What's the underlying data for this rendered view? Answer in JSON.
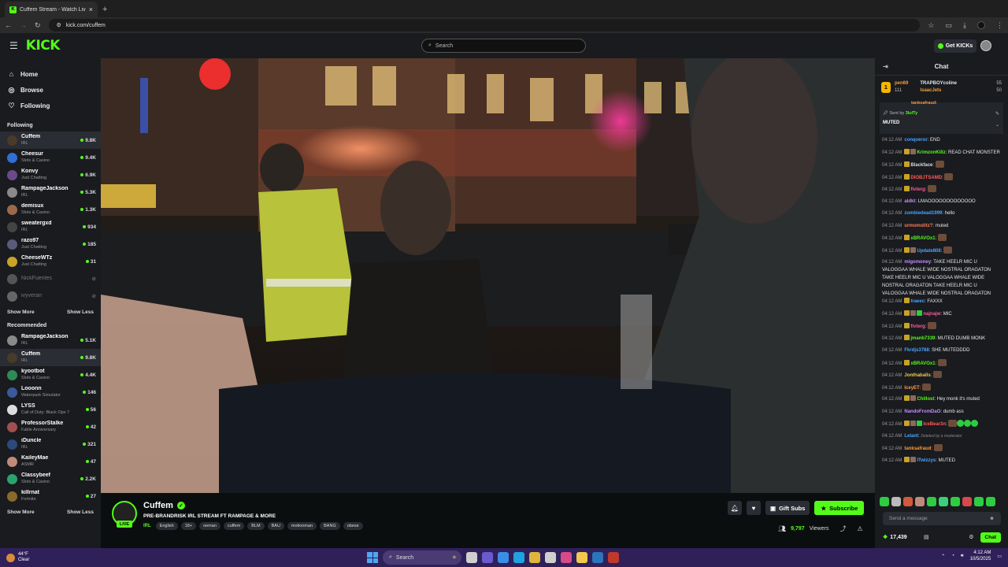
{
  "browser": {
    "tab_title": "Cuffem Stream - Watch Live on Kick",
    "url": "kick.com/cuffem",
    "new_tab_icon": "+"
  },
  "topnav": {
    "logo": "KICK",
    "search_placeholder": "Search",
    "get_kicks": "Get KICKs"
  },
  "sidebar": {
    "nav": [
      {
        "label": "Home",
        "icon": "home-icon"
      },
      {
        "label": "Browse",
        "icon": "compass-icon"
      },
      {
        "label": "Following",
        "icon": "heart-icon"
      }
    ],
    "following_header": "Following",
    "following": [
      {
        "name": "Cuffem",
        "category": "IRL",
        "viewers": "9.8K",
        "color": "#4a3a2a",
        "active": true
      },
      {
        "name": "Cheesur",
        "category": "Slots & Casino",
        "viewers": "9.4K",
        "color": "#2f6fd6"
      },
      {
        "name": "Konvy",
        "category": "Just Chatting",
        "viewers": "6.9K",
        "color": "#6b4a8a"
      },
      {
        "name": "RampageJackson",
        "category": "IRL",
        "viewers": "5.3K",
        "color": "#8a8a8a"
      },
      {
        "name": "demisux",
        "category": "Slots & Casino",
        "viewers": "1.3K",
        "color": "#9a6a4a"
      },
      {
        "name": "sweatergxd",
        "category": "IRL",
        "viewers": "934",
        "color": "#444"
      },
      {
        "name": "razo97",
        "category": "Just Chatting",
        "viewers": "185",
        "color": "#5a5a7a"
      },
      {
        "name": "CheeseWTz",
        "category": "Just Chatting",
        "viewers": "31",
        "color": "#c9a227"
      },
      {
        "name": "NickFuentes",
        "category": "",
        "viewers": "",
        "color": "#555",
        "offline": true
      },
      {
        "name": "ivyveran",
        "category": "",
        "viewers": "",
        "color": "#666",
        "offline": true
      }
    ],
    "show_more": "Show More",
    "show_less": "Show Less",
    "recommended_header": "Recommended",
    "recommended": [
      {
        "name": "RampageJackson",
        "category": "IRL",
        "viewers": "5.1K",
        "color": "#8a8a8a"
      },
      {
        "name": "Cuffem",
        "category": "IRL",
        "viewers": "9.8K",
        "color": "#4a3a2a",
        "active": true
      },
      {
        "name": "kyootbot",
        "category": "Slots & Casino",
        "viewers": "4.4K",
        "color": "#2e8b57"
      },
      {
        "name": "Looonn",
        "category": "Waterpark Simulator",
        "viewers": "146",
        "color": "#3a5a9a"
      },
      {
        "name": "LYSS",
        "category": "Call of Duty: Black Ops 7",
        "viewers": "56",
        "color": "#ddd"
      },
      {
        "name": "ProfessorStalke",
        "category": "Fable Anniversary",
        "viewers": "42",
        "color": "#a05050"
      },
      {
        "name": "iDuncle",
        "category": "IRL",
        "viewers": "321",
        "color": "#2a4a7a"
      },
      {
        "name": "KaileyMae",
        "category": "ASMR",
        "viewers": "47",
        "color": "#c08a7a"
      },
      {
        "name": "Classybeef",
        "category": "Slots & Casino",
        "viewers": "2.2K",
        "color": "#2ba36a"
      },
      {
        "name": "killrnat",
        "category": "Fortnite",
        "viewers": "27",
        "color": "#8a6a2a"
      }
    ]
  },
  "stream": {
    "channel": "Cuffem",
    "live_label": "LIVE",
    "title": "PRE-BRANDRISK IRL STREAM FT RAMPAGE & MORE",
    "category": "IRL",
    "tags": [
      "English",
      "18+",
      "oeman",
      "cuffem",
      "BLM",
      "BAU",
      "motionman",
      "BANG",
      "obese"
    ],
    "gift_subs": "Gift Subs",
    "subscribe": "Subscribe",
    "viewers": "9,797",
    "viewers_label": "Viewers"
  },
  "chat": {
    "title": "Chat",
    "leaderboard": {
      "first": {
        "name": "pen69",
        "count": "111"
      },
      "second": {
        "name": "TRAPBOYcoline",
        "count": "55"
      },
      "third": {
        "name": "IsaacJets",
        "count": "50"
      }
    },
    "pinned": {
      "header_user": "tanksafraud:",
      "sent_by_label": "Sent by",
      "sent_by": "3lulTy",
      "message": "MUTED"
    },
    "messages": [
      {
        "time": "04:12 AM",
        "user": "conqveror",
        "color": "#4aa3ff",
        "text": "END"
      },
      {
        "time": "04:12 AM",
        "user": "KrimzonKillz",
        "color": "#53fc18",
        "text": "READ CHAT MONSTER",
        "badges": 2
      },
      {
        "time": "04:12 AM",
        "user": "Blackface",
        "color": "#dddddd",
        "text": "",
        "badges": 1,
        "emote": true
      },
      {
        "time": "04:12 AM",
        "user": "DIOBJTSAMD",
        "color": "#ff5a5a",
        "text": "",
        "badges": 1,
        "emote": true
      },
      {
        "time": "04:12 AM",
        "user": "fivterg",
        "color": "#ff5a9a",
        "text": "",
        "badges": 1,
        "emote": true
      },
      {
        "time": "04:12 AM",
        "user": "aldkt",
        "color": "#c78bff",
        "text": "LMAOOOOOOOOOOOOO"
      },
      {
        "time": "04:12 AM",
        "user": "zombiedead1999",
        "color": "#4aa3ff",
        "text": "hello"
      },
      {
        "time": "04:12 AM",
        "user": "urmomstitz?",
        "color": "#ff7a5a",
        "text": "muted"
      },
      {
        "time": "04:12 AM",
        "user": "xBRAVOx1",
        "color": "#53fc18",
        "text": "",
        "badges": 1,
        "emote": true
      },
      {
        "time": "04:12 AM",
        "user": "Update808",
        "color": "#4aa3ff",
        "text": "",
        "badges": 2,
        "emote": true
      },
      {
        "time": "04:12 AM",
        "user": "migomoney",
        "color": "#c78bff",
        "text": "TAKE HEELR MIC U VALOGGAA WHALE WIDE NOSTRAL ORAGATON TAKE HEELR MIC U VALOGGAA WHALE WIDE NOSTRAL ORAGATON TAKE HEELR MIC U VALOGGAA WHALE WIDE NOSTRAL ORAGATON"
      },
      {
        "time": "04:12 AM",
        "user": "traeec",
        "color": "#4aa3ff",
        "text": "FAXXX",
        "badges": 1
      },
      {
        "time": "04:12 AM",
        "user": "najnajw",
        "color": "#ff5a9a",
        "text": "MIC",
        "badges": 3
      },
      {
        "time": "04:12 AM",
        "user": "fivterg",
        "color": "#ff5a9a",
        "text": "",
        "badges": 1,
        "emote": true
      },
      {
        "time": "04:12 AM",
        "user": "jmanb7339",
        "color": "#53fc18",
        "text": "MUTED DUMB MONK",
        "badges": 1
      },
      {
        "time": "04:12 AM",
        "user": "Fkrdjs3788",
        "color": "#4aa3ff",
        "text": "SHE MUTEDDDD"
      },
      {
        "time": "04:12 AM",
        "user": "xBRAVOx1",
        "color": "#53fc18",
        "text": "",
        "badges": 1,
        "emote": true
      },
      {
        "time": "04:12 AM",
        "user": "Jonthaballs",
        "color": "#f2c94c",
        "text": "",
        "emote": true
      },
      {
        "time": "04:12 AM",
        "user": "IceyET",
        "color": "#ff9a3a",
        "text": "",
        "emote": true
      },
      {
        "time": "04:12 AM",
        "user": "Chillost",
        "color": "#53fc18",
        "text": "Hey monk it's muted",
        "badges": 2
      },
      {
        "time": "04:12 AM",
        "user": "NandoFromDaO",
        "color": "#c78bff",
        "text": "dumb ass"
      },
      {
        "time": "04:12 AM",
        "user": "IceBear3n",
        "color": "#ff5a5a",
        "text": "",
        "badges": 3,
        "emote": true
      },
      {
        "time": "04:12 AM",
        "user": "Lelant",
        "color": "#4aa3ff",
        "text": "Deleted by a moderator",
        "deleted": true
      },
      {
        "time": "04:12 AM",
        "user": "tanksafraud",
        "color": "#ff9a3a",
        "text": "",
        "emote": true
      },
      {
        "time": "04:12 AM",
        "user": "ITwizzys",
        "color": "#4aa3ff",
        "text": "MUTED",
        "badges": 2
      }
    ],
    "send_placeholder": "Send a message",
    "points": "17,439",
    "chat_button": "Chat"
  },
  "taskbar": {
    "weather_temp": "44°F",
    "weather_cond": "Clear",
    "search": "Search",
    "time": "4:12 AM",
    "date": "10/5/2025"
  }
}
